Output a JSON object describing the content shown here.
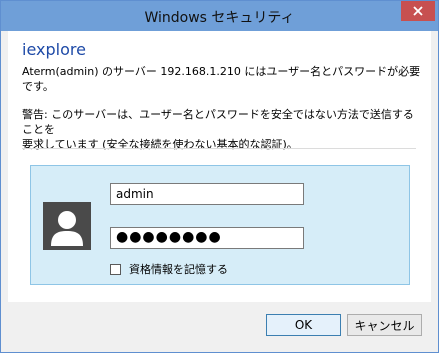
{
  "window": {
    "title": "Windows セキュリティ"
  },
  "dialog": {
    "app_name": "iexplore",
    "message_line1": "Aterm(admin) のサーバー 192.168.1.210 にはユーザー名とパスワードが必要",
    "message_line2": "です。",
    "warning_line1": "警告: このサーバーは、ユーザー名とパスワードを安全ではない方法で送信することを",
    "warning_line2": "要求しています (安全な接続を使わない基本的な認証)。"
  },
  "credentials": {
    "username_value": "admin",
    "password_value": "●●●●●●●●",
    "remember_label": "資格情報を記憶する",
    "remember_checked": false
  },
  "buttons": {
    "ok_label": "OK",
    "cancel_label": "キャンセル"
  },
  "icons": {
    "close": "close-icon",
    "avatar": "user-avatar-icon"
  },
  "colors": {
    "titlebar": "#6f9fd8",
    "close": "#c75050",
    "app_name": "#1e4aa7",
    "panel": "#d6edf8"
  }
}
